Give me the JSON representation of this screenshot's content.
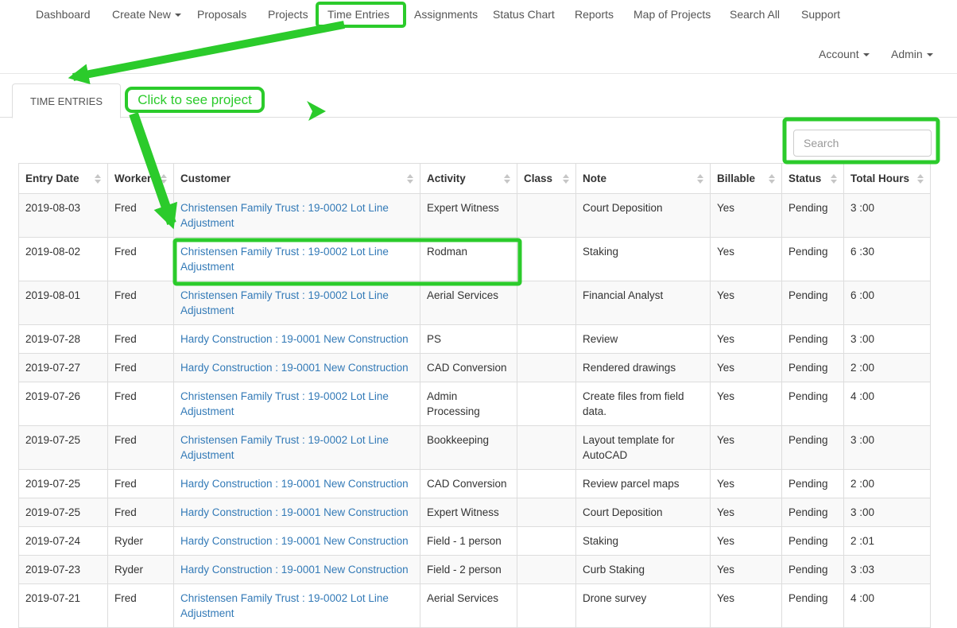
{
  "nav": {
    "items": [
      {
        "label": "Dashboard"
      },
      {
        "label": "Create New",
        "has_caret": true
      },
      {
        "label": "Proposals"
      },
      {
        "label": "Projects"
      },
      {
        "label": "Time Entries",
        "highlighted": true
      },
      {
        "label": "Assignments"
      },
      {
        "label": "Status Chart"
      },
      {
        "label": "Reports"
      },
      {
        "label": "Map of Projects"
      },
      {
        "label": "Search All"
      },
      {
        "label": "Support"
      }
    ],
    "account_label": "Account",
    "admin_label": "Admin"
  },
  "tab": {
    "label": "TIME ENTRIES"
  },
  "annotations": {
    "click_note": "Click to see project"
  },
  "search": {
    "placeholder": "Search"
  },
  "table": {
    "columns": [
      "Entry Date",
      "Worker",
      "Customer",
      "Activity",
      "Class",
      "Note",
      "Billable",
      "Status",
      "Total Hours"
    ],
    "column_keys": [
      "entry_date",
      "worker",
      "customer",
      "activity",
      "class",
      "note",
      "billable",
      "status",
      "total_hours"
    ],
    "rows": [
      {
        "entry_date": "2019-08-03",
        "worker": "Fred",
        "customer": "Christensen Family Trust : 19-0002 Lot Line Adjustment",
        "activity": "Expert Witness",
        "class": "",
        "note": "Court Deposition",
        "billable": "Yes",
        "status": "Pending",
        "total_hours": "3 :00"
      },
      {
        "entry_date": "2019-08-02",
        "worker": "Fred",
        "customer": "Christensen Family Trust : 19-0002 Lot Line Adjustment",
        "activity": "Rodman",
        "class": "",
        "note": "Staking",
        "billable": "Yes",
        "status": "Pending",
        "total_hours": "6 :30"
      },
      {
        "entry_date": "2019-08-01",
        "worker": "Fred",
        "customer": "Christensen Family Trust : 19-0002 Lot Line Adjustment",
        "activity": "Aerial Services",
        "class": "",
        "note": "Financial Analyst",
        "billable": "Yes",
        "status": "Pending",
        "total_hours": "6 :00"
      },
      {
        "entry_date": "2019-07-28",
        "worker": "Fred",
        "customer": "Hardy Construction : 19-0001 New Construction",
        "activity": "PS",
        "class": "",
        "note": "Review",
        "billable": "Yes",
        "status": "Pending",
        "total_hours": "3 :00"
      },
      {
        "entry_date": "2019-07-27",
        "worker": "Fred",
        "customer": "Hardy Construction : 19-0001 New Construction",
        "activity": "CAD Conversion",
        "class": "",
        "note": "Rendered drawings",
        "billable": "Yes",
        "status": "Pending",
        "total_hours": "2 :00"
      },
      {
        "entry_date": "2019-07-26",
        "worker": "Fred",
        "customer": "Christensen Family Trust : 19-0002 Lot Line Adjustment",
        "activity": "Admin Processing",
        "class": "",
        "note": "Create files from field data.",
        "billable": "Yes",
        "status": "Pending",
        "total_hours": "4 :00"
      },
      {
        "entry_date": "2019-07-25",
        "worker": "Fred",
        "customer": "Christensen Family Trust : 19-0002 Lot Line Adjustment",
        "activity": "Bookkeeping",
        "class": "",
        "note": "Layout template for AutoCAD",
        "billable": "Yes",
        "status": "Pending",
        "total_hours": "3 :00"
      },
      {
        "entry_date": "2019-07-25",
        "worker": "Fred",
        "customer": "Hardy Construction : 19-0001 New Construction",
        "activity": "CAD Conversion",
        "class": "",
        "note": "Review parcel maps",
        "billable": "Yes",
        "status": "Pending",
        "total_hours": "2 :00"
      },
      {
        "entry_date": "2019-07-25",
        "worker": "Fred",
        "customer": "Hardy Construction : 19-0001 New Construction",
        "activity": "Expert Witness",
        "class": "",
        "note": "Court Deposition",
        "billable": "Yes",
        "status": "Pending",
        "total_hours": "3 :00"
      },
      {
        "entry_date": "2019-07-24",
        "worker": "Ryder",
        "customer": "Hardy Construction : 19-0001 New Construction",
        "activity": "Field - 1 person",
        "class": "",
        "note": "Staking",
        "billable": "Yes",
        "status": "Pending",
        "total_hours": "2 :01"
      },
      {
        "entry_date": "2019-07-23",
        "worker": "Ryder",
        "customer": "Hardy Construction : 19-0001 New Construction",
        "activity": "Field - 2 person",
        "class": "",
        "note": "Curb Staking",
        "billable": "Yes",
        "status": "Pending",
        "total_hours": "3 :03"
      },
      {
        "entry_date": "2019-07-21",
        "worker": "Fred",
        "customer": "Christensen Family Trust : 19-0002 Lot Line Adjustment",
        "activity": "Aerial Services",
        "class": "",
        "note": "Drone survey",
        "billable": "Yes",
        "status": "Pending",
        "total_hours": "4 :00"
      }
    ]
  },
  "colors": {
    "annotation_green": "#2bcb2b",
    "link_blue": "#337ab7",
    "stripe": "#f9f9f9",
    "border": "#dddddd"
  }
}
